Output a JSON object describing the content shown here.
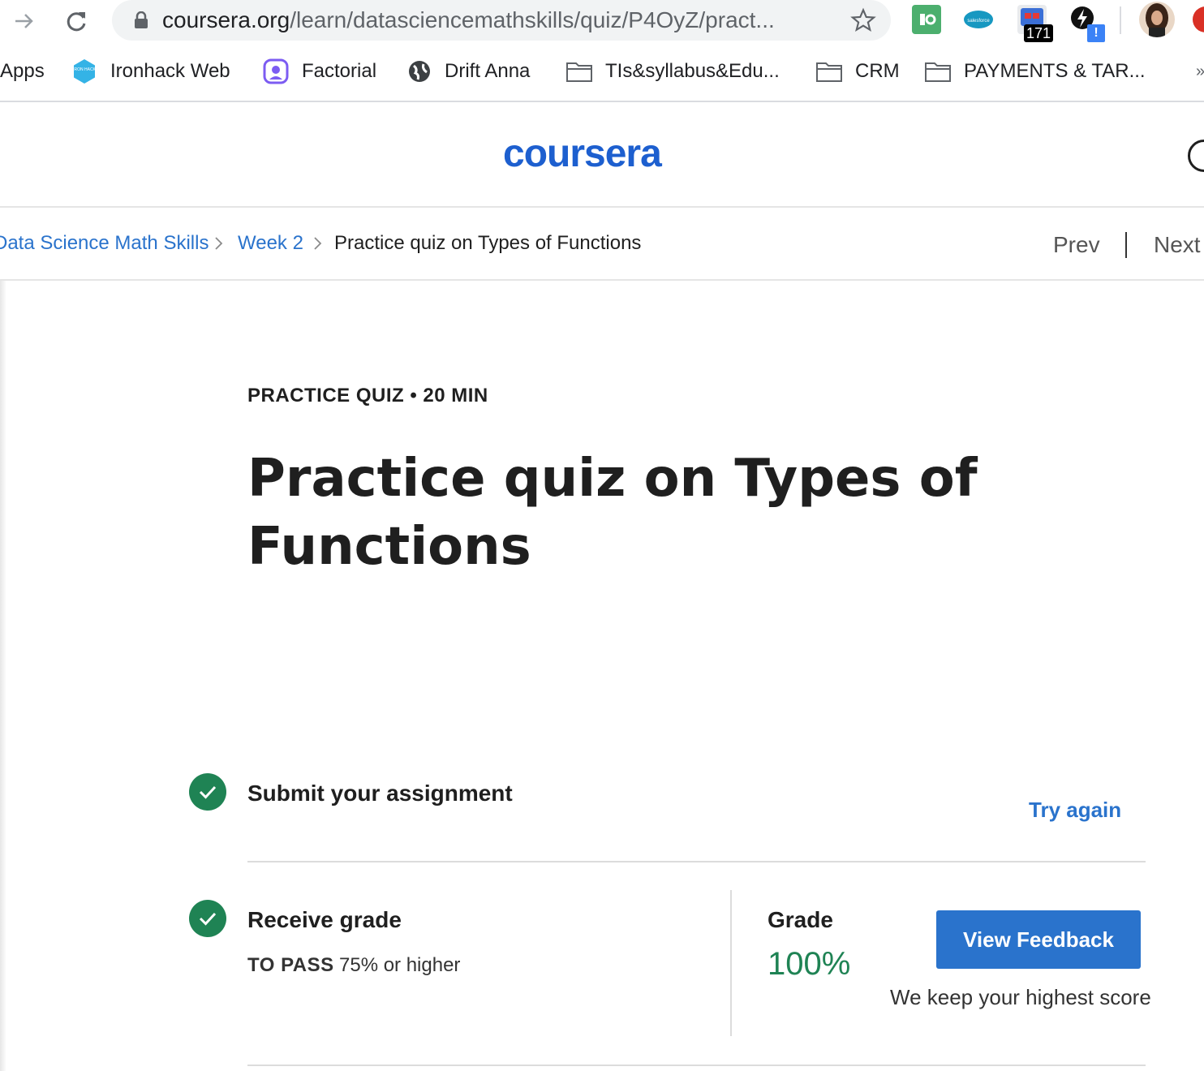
{
  "browser": {
    "url_host": "coursera.org",
    "url_path": "/learn/datasciencemathskills/quiz/P4OyZ/pract...",
    "extension_badge": "171",
    "extension_alert": "!",
    "extension_salesforce_text": "salesforce",
    "bookmarks": [
      {
        "label": "Apps",
        "icon": "apps-grid-icon"
      },
      {
        "label": "Ironhack Web",
        "icon": "ironhack-icon"
      },
      {
        "label": "Factorial",
        "icon": "factorial-icon"
      },
      {
        "label": "Drift Anna",
        "icon": "globe-icon"
      },
      {
        "label": "TIs&syllabus&Edu...",
        "icon": "folder-icon"
      },
      {
        "label": "CRM",
        "icon": "folder-icon"
      },
      {
        "label": "PAYMENTS & TAR...",
        "icon": "folder-icon"
      }
    ],
    "bookmark_overflow": "»",
    "ironhack_icon_text": "IRON HACK"
  },
  "header": {
    "logo": "coursera"
  },
  "breadcrumb": {
    "items": [
      "Data Science Math Skills",
      "Week 2",
      "Practice quiz on Types of Functions"
    ],
    "prev": "Prev",
    "next": "Next"
  },
  "quiz": {
    "meta": "PRACTICE QUIZ • 20 MIN",
    "title": "Practice quiz on Types of Functions"
  },
  "steps": {
    "submit": {
      "title": "Submit your assignment",
      "action": "Try again"
    },
    "grade": {
      "title": "Receive grade",
      "pass_label": "TO PASS",
      "pass_value": "75% or higher",
      "grade_label": "Grade",
      "grade_value": "100%",
      "button": "View Feedback",
      "note": "We keep your highest score"
    }
  },
  "colors": {
    "accent": "#2a73cc",
    "logo": "#1d5fcf",
    "success": "#1f8354"
  }
}
